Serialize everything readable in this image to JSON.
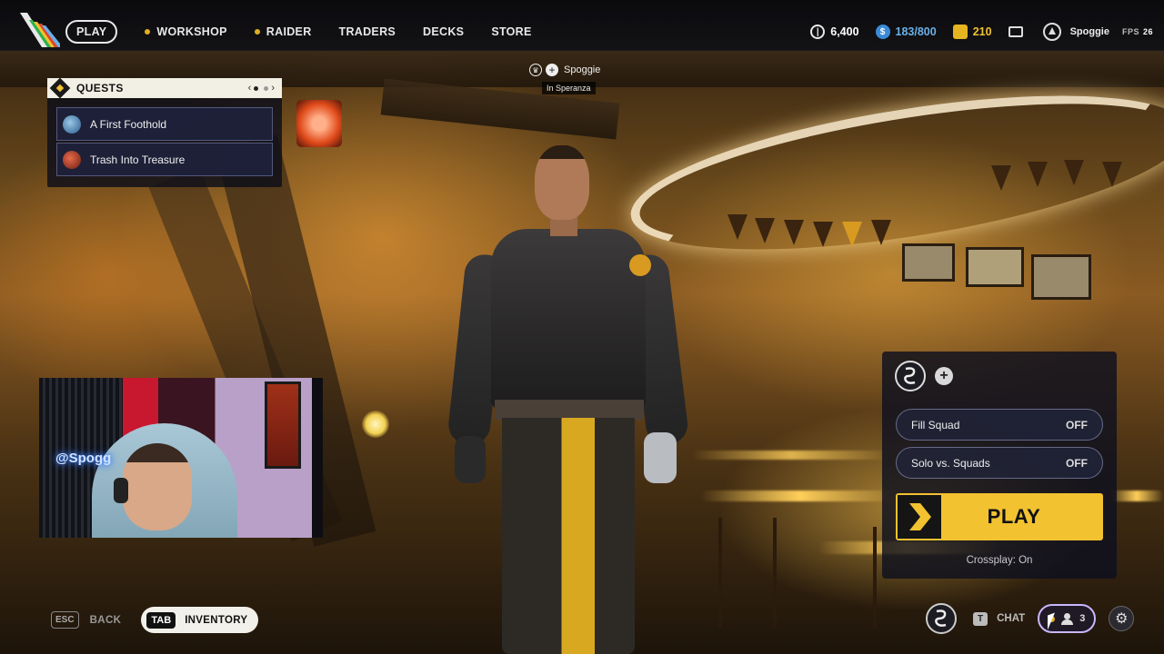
{
  "nav": {
    "items": [
      {
        "label": "PLAY",
        "active": true,
        "dot": false
      },
      {
        "label": "WORKSHOP",
        "active": false,
        "dot": true
      },
      {
        "label": "RAIDER",
        "active": false,
        "dot": true
      },
      {
        "label": "TRADERS",
        "active": false,
        "dot": false
      },
      {
        "label": "DECKS",
        "active": false,
        "dot": false
      },
      {
        "label": "STORE",
        "active": false,
        "dot": false
      }
    ]
  },
  "currencies": {
    "coins": "6,400",
    "tokens": "183/800",
    "seeds": "210"
  },
  "player": {
    "name": "Spoggie",
    "location": "In Speranza"
  },
  "fps": {
    "label": "FPS",
    "value": "26"
  },
  "quests": {
    "title": "QUESTS",
    "pager": {
      "prev": "‹",
      "next": "›"
    },
    "items": [
      {
        "name": "A First Foothold",
        "icon": "blue"
      },
      {
        "name": "Trash Into Treasure",
        "icon": "red"
      }
    ]
  },
  "webcam": {
    "neon_text": "@Spogg"
  },
  "play_panel": {
    "fill_squad": {
      "label": "Fill Squad",
      "state": "OFF"
    },
    "solo_vs_squads": {
      "label": "Solo vs. Squads",
      "state": "OFF"
    },
    "play_label": "PLAY",
    "crossplay": "Crossplay: On"
  },
  "bottom": {
    "back_key": "ESC",
    "back_label": "BACK",
    "inventory_key": "TAB",
    "inventory_label": "INVENTORY",
    "chat_key": "T",
    "chat_label": "CHAT",
    "friends_count": "3"
  },
  "colors": {
    "accent_yellow": "#f2c230",
    "token_blue": "#6ab0e8",
    "panel_bg": "#0e101e",
    "highlight_purple": "#c9b7ff"
  },
  "icons": {
    "coins": "coin-icon",
    "tokens": "token-icon",
    "seeds": "seed-icon",
    "mail": "mail-icon",
    "rank": "rank-icon",
    "settings": "gear-icon",
    "friends": "friends-icon"
  }
}
